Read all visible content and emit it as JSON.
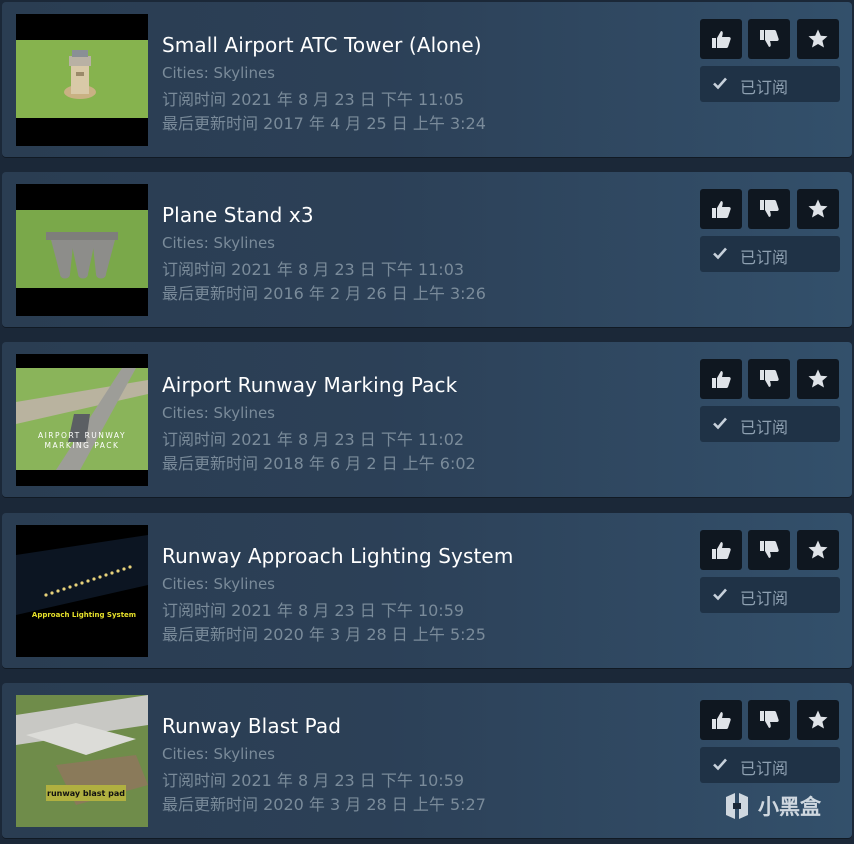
{
  "items": [
    {
      "title": "Small Airport ATC Tower (Alone)",
      "game": "Cities: Skylines",
      "subscribed_time": "订阅时间 2021 年 8 月 23 日 下午 11:05",
      "updated_time": "最后更新时间 2017 年 4 月 25 日 上午 3:24",
      "subscribed_label": "已订阅"
    },
    {
      "title": "Plane Stand x3",
      "game": "Cities: Skylines",
      "subscribed_time": "订阅时间 2021 年 8 月 23 日 下午 11:03",
      "updated_time": "最后更新时间 2016 年 2 月 26 日 上午 3:26",
      "subscribed_label": "已订阅"
    },
    {
      "title": "Airport Runway Marking Pack",
      "game": "Cities: Skylines",
      "subscribed_time": "订阅时间 2021 年 8 月 23 日 下午 11:02",
      "updated_time": "最后更新时间 2018 年 6 月 2 日 上午 6:02",
      "subscribed_label": "已订阅",
      "thumb_text": "AIRPORT RUNWAY MARKING PACK"
    },
    {
      "title": "Runway Approach Lighting System",
      "game": "Cities: Skylines",
      "subscribed_time": "订阅时间 2021 年 8 月 23 日 下午 10:59",
      "updated_time": "最后更新时间 2020 年 3 月 28 日 上午 5:25",
      "subscribed_label": "已订阅",
      "thumb_text": "Approach Lighting System"
    },
    {
      "title": "Runway Blast Pad",
      "game": "Cities: Skylines",
      "subscribed_time": "订阅时间 2021 年 8 月 23 日 下午 10:59",
      "updated_time": "最后更新时间 2020 年 3 月 28 日 上午 5:27",
      "subscribed_label": "已订阅",
      "thumb_text": "runway blast pad"
    }
  ],
  "buttons": {
    "upvote_icon": "thumbs-up-icon",
    "downvote_icon": "thumbs-down-icon",
    "favorite_icon": "star-icon"
  },
  "watermark": {
    "text": "小黑盒"
  },
  "colors": {
    "background": "#1b2838",
    "title": "#ffffff",
    "meta_text": "#7a8b9a",
    "button_bg": "#0f1720",
    "subscribed_bg": "#1f3246",
    "thumb_green": "#7fae4a"
  }
}
